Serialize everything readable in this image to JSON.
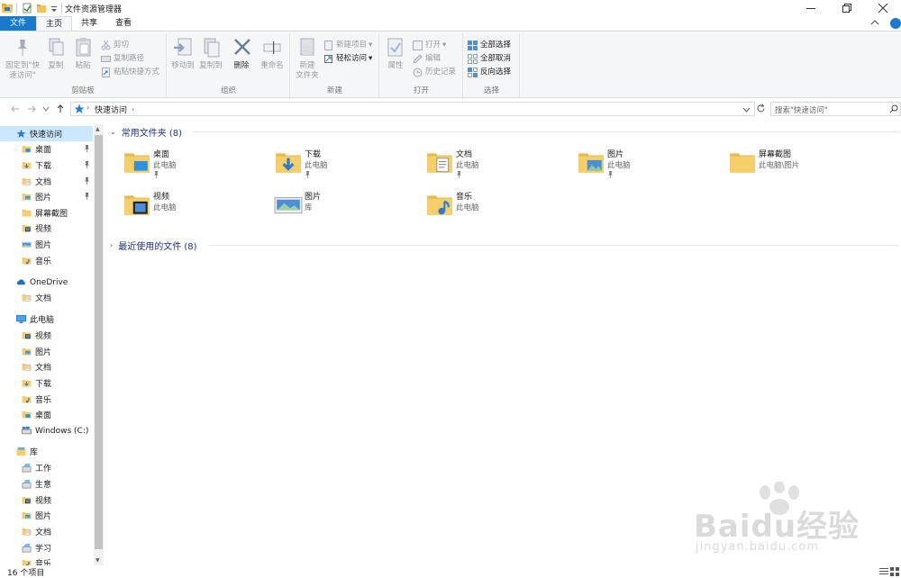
{
  "window": {
    "title": "文件资源管理器"
  },
  "ribbon_tabs": {
    "file": "文件",
    "home": "主页",
    "share": "共享",
    "view": "查看"
  },
  "ribbon": {
    "clipboard": {
      "label": "剪贴板",
      "pin": "固定到\"快\n速访问\"",
      "copy": "复制",
      "paste": "粘贴",
      "cut": "剪切",
      "copy_path": "复制路径",
      "paste_shortcut": "粘贴快捷方式"
    },
    "organize": {
      "label": "组织",
      "move_to": "移动到",
      "copy_to": "复制到",
      "delete": "删除",
      "rename": "重命名"
    },
    "new": {
      "label": "新建",
      "new_folder": "新建\n文件夹",
      "new_item": "新建项目",
      "easy_access": "轻松访问"
    },
    "open": {
      "label": "打开",
      "properties": "属性",
      "open": "打开",
      "edit": "编辑",
      "history": "历史记录"
    },
    "select": {
      "label": "选择",
      "select_all": "全部选择",
      "select_none": "全部取消",
      "invert": "反向选择"
    }
  },
  "address": {
    "path": "快速访问",
    "search_placeholder": "搜索\"快速访问\""
  },
  "sidebar": {
    "items": [
      {
        "label": "快速访问",
        "icon": "star-icon",
        "pinned": false,
        "indent": 0,
        "selected": true
      },
      {
        "label": "桌面",
        "icon": "desktop-folder-icon",
        "pinned": true,
        "indent": 1
      },
      {
        "label": "下载",
        "icon": "download-folder-icon",
        "pinned": true,
        "indent": 1
      },
      {
        "label": "文档",
        "icon": "documents-folder-icon",
        "pinned": true,
        "indent": 1
      },
      {
        "label": "图片",
        "icon": "pictures-folder-icon",
        "pinned": true,
        "indent": 1
      },
      {
        "label": "屏幕截图",
        "icon": "folder-icon",
        "pinned": false,
        "indent": 1
      },
      {
        "label": "视频",
        "icon": "videos-folder-icon",
        "pinned": false,
        "indent": 1
      },
      {
        "label": "图片",
        "icon": "pictures-library-icon",
        "pinned": false,
        "indent": 1
      },
      {
        "label": "音乐",
        "icon": "music-folder-icon",
        "pinned": false,
        "indent": 1
      },
      {
        "label": "OneDrive",
        "icon": "onedrive-icon",
        "pinned": false,
        "indent": 0
      },
      {
        "label": "文档",
        "icon": "documents-folder-icon",
        "pinned": false,
        "indent": 1
      },
      {
        "label": "此电脑",
        "icon": "computer-icon",
        "pinned": false,
        "indent": 0
      },
      {
        "label": "视频",
        "icon": "videos-folder-icon",
        "pinned": false,
        "indent": 1
      },
      {
        "label": "图片",
        "icon": "pictures-folder-icon",
        "pinned": false,
        "indent": 1
      },
      {
        "label": "文档",
        "icon": "documents-folder-icon",
        "pinned": false,
        "indent": 1
      },
      {
        "label": "下载",
        "icon": "download-folder-icon",
        "pinned": false,
        "indent": 1
      },
      {
        "label": "音乐",
        "icon": "music-folder-icon",
        "pinned": false,
        "indent": 1
      },
      {
        "label": "桌面",
        "icon": "desktop-folder-icon",
        "pinned": false,
        "indent": 1
      },
      {
        "label": "Windows (C:)",
        "icon": "drive-icon",
        "pinned": false,
        "indent": 1
      },
      {
        "label": "库",
        "icon": "library-icon",
        "pinned": false,
        "indent": 0
      },
      {
        "label": "工作",
        "icon": "library-item-icon",
        "pinned": false,
        "indent": 1
      },
      {
        "label": "生意",
        "icon": "library-item-icon",
        "pinned": false,
        "indent": 1
      },
      {
        "label": "视频",
        "icon": "videos-folder-icon",
        "pinned": false,
        "indent": 1
      },
      {
        "label": "图片",
        "icon": "pictures-folder-icon",
        "pinned": false,
        "indent": 1
      },
      {
        "label": "文档",
        "icon": "documents-folder-icon",
        "pinned": false,
        "indent": 1
      },
      {
        "label": "学习",
        "icon": "library-item-icon",
        "pinned": false,
        "indent": 1
      },
      {
        "label": "音乐",
        "icon": "music-folder-icon",
        "pinned": false,
        "indent": 1
      }
    ]
  },
  "main": {
    "frequent_heading": "常用文件夹 (8)",
    "recent_heading": "最近使用的文件 (8)",
    "folders": [
      {
        "name": "桌面",
        "location": "此电脑",
        "pinned": true,
        "icon": "desktop-folder-icon"
      },
      {
        "name": "下载",
        "location": "此电脑",
        "pinned": true,
        "icon": "download-folder-icon"
      },
      {
        "name": "文档",
        "location": "此电脑",
        "pinned": true,
        "icon": "documents-folder-icon"
      },
      {
        "name": "图片",
        "location": "此电脑",
        "pinned": true,
        "icon": "pictures-folder-icon"
      },
      {
        "name": "屏幕截图",
        "location": "此电脑\\图片",
        "pinned": false,
        "icon": "folder-icon"
      },
      {
        "name": "视频",
        "location": "此电脑",
        "pinned": false,
        "icon": "videos-folder-icon"
      },
      {
        "name": "图片",
        "location": "库",
        "pinned": false,
        "icon": "pictures-library-icon"
      },
      {
        "name": "音乐",
        "location": "此电脑",
        "pinned": false,
        "icon": "music-folder-icon"
      }
    ]
  },
  "status": {
    "item_count": "16 个项目"
  },
  "watermark": {
    "brand": "Baidu经验",
    "url": "jingyan.baidu.com"
  },
  "colors": {
    "accent": "#1979ca",
    "folder": "#f3c35a",
    "selection": "#cce8ff",
    "heading": "#1e3287"
  }
}
